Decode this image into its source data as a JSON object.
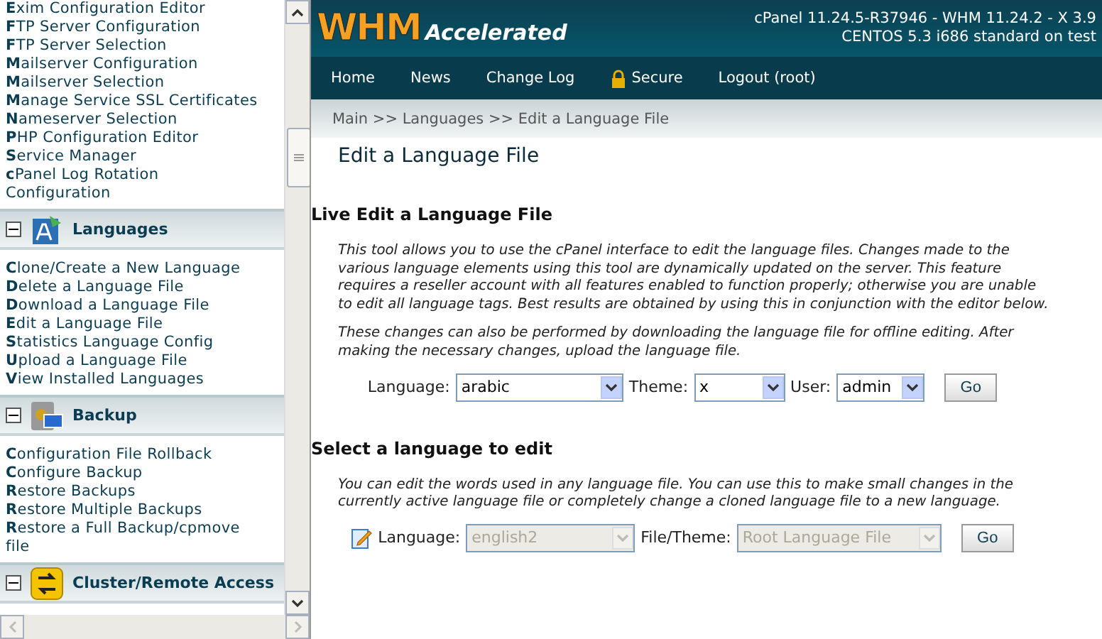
{
  "sidebar": {
    "top_items": [
      "**E**xim Configuration Editor",
      "**F**TP Server Configuration",
      "**F**TP Server Selection",
      "**M**ailserver Configuration",
      "**M**ailserver Selection",
      "**M**anage Service SSL Certificates",
      "**N**ameserver Selection",
      "**P**HP Configuration Editor",
      "**S**ervice Manager",
      "**c**Panel Log Rotation Configuration"
    ],
    "sections": [
      {
        "title": "Languages",
        "expanded": true,
        "items": [
          "**C**lone/Create a New Language",
          "**D**elete a Language File",
          "**D**ownload a Language File",
          "**E**dit a Language File",
          "**S**tatistics Language Config",
          "**U**pload a Language File",
          "**V**iew Installed Languages"
        ]
      },
      {
        "title": "Backup",
        "expanded": true,
        "items": [
          "**C**onfiguration File Rollback",
          "**C**onfigure Backup",
          "**R**estore Backups",
          "**R**estore Multiple Backups",
          "**R**estore a Full Backup/cpmove file"
        ]
      },
      {
        "title": "Cluster/Remote Access",
        "expanded": true
      }
    ]
  },
  "header": {
    "logo_main": "WHM",
    "logo_sub": "Accelerated",
    "version_lines": [
      "cPanel 11.24.5-R37946 - WHM 11.24.2 - X 3.9",
      "CENTOS 5.3 i686 standard on test"
    ]
  },
  "nav": [
    {
      "label": "Home",
      "lock": false
    },
    {
      "label": "News",
      "lock": false
    },
    {
      "label": "Change Log",
      "lock": false
    },
    {
      "label": "Secure",
      "lock": true
    },
    {
      "label": "Logout (root)",
      "lock": false
    }
  ],
  "breadcrumb": "Main >> Languages >> Edit a Language File",
  "page_title": "Edit a Language File",
  "sections": [
    {
      "heading": "Live Edit a Language File",
      "paragraphs": [
        "This tool allows you to use the cPanel interface to edit the language files. Changes made to the various language elements using this tool are dynamically updated on the server. This feature requires a reseller account with all features enabled to function properly; otherwise you are unable to edit all language tags. Best results are obtained by using this in conjunction with the editor below.",
        "These changes can also be performed by downloading the language file for offline editing. After making the necessary changes, upload the language file."
      ],
      "edit_icon": false,
      "fields": [
        {
          "label": "Language:",
          "value": "arabic",
          "disabled": false
        },
        {
          "label": "Theme:",
          "value": "x",
          "disabled": false
        },
        {
          "label": "User:",
          "value": "admin",
          "disabled": false
        }
      ],
      "button": "Go"
    },
    {
      "heading": "Select a language to edit",
      "paragraphs": [
        "You can edit the words used in any language file. You can use this to make small changes in the currently active language file or completely change a cloned language file to a new language."
      ],
      "edit_icon": true,
      "fields": [
        {
          "label": "Language:",
          "value": "english2",
          "disabled": true
        },
        {
          "label": "File/Theme:",
          "value": "Root Language File",
          "disabled": true
        }
      ],
      "button": "Go"
    }
  ]
}
